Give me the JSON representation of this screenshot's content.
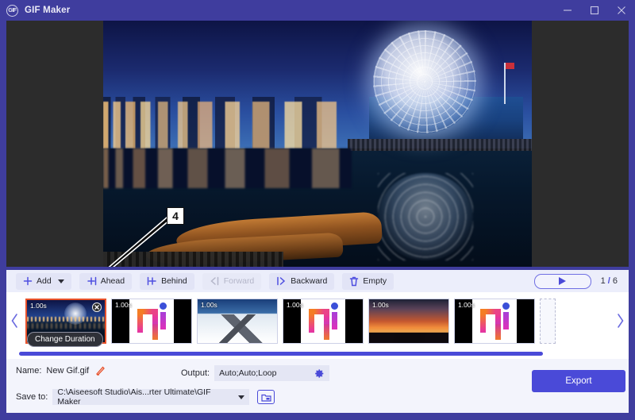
{
  "window": {
    "title": "GIF Maker",
    "app_icon": "gif-badge-icon",
    "minimize": "minimize-icon",
    "maximize": "maximize-icon",
    "close": "close-icon",
    "titlebar_color": "#3f3d9e"
  },
  "preview": {
    "description": "Night cityscape with illuminated geodesic dome, waterfront reflection and wooden canoes"
  },
  "annotation": {
    "number": "4",
    "arrow": "arrow-pointing-to-add-button"
  },
  "toolbar": {
    "buttons": [
      {
        "label": "Add",
        "icon": "plus-icon",
        "has_dropdown": true,
        "disabled": false
      },
      {
        "label": "Ahead",
        "icon": "insert-ahead-icon",
        "has_dropdown": false,
        "disabled": false
      },
      {
        "label": "Behind",
        "icon": "insert-behind-icon",
        "has_dropdown": false,
        "disabled": false
      },
      {
        "label": "Forward",
        "icon": "move-forward-icon",
        "has_dropdown": false,
        "disabled": true
      },
      {
        "label": "Backward",
        "icon": "move-backward-icon",
        "has_dropdown": false,
        "disabled": false
      },
      {
        "label": "Empty",
        "icon": "trash-icon",
        "has_dropdown": false,
        "disabled": false
      }
    ],
    "play_icon": "play-icon",
    "counter_current": "1",
    "counter_sep": "/",
    "counter_total": "6"
  },
  "strip": {
    "prev_icon": "chevron-left-icon",
    "next_icon": "chevron-right-icon",
    "tooltip": "Change Duration",
    "close_icon": "close-circle-icon",
    "frames": [
      {
        "duration": "1.00s",
        "kind": "citynight",
        "selected": true
      },
      {
        "duration": "1.00s",
        "kind": "ai-logo",
        "selected": false
      },
      {
        "duration": "1.00s",
        "kind": "mountain",
        "selected": false
      },
      {
        "duration": "1.00s",
        "kind": "ai-logo",
        "selected": false
      },
      {
        "duration": "1.00s",
        "kind": "sunset",
        "selected": false
      },
      {
        "duration": "1.00s",
        "kind": "ai-logo",
        "selected": false
      }
    ]
  },
  "bottom": {
    "name_label": "Name:",
    "name_value": "New Gif.gif",
    "edit_icon": "pencil-icon",
    "output_label": "Output:",
    "output_value": "Auto;Auto;Loop",
    "gear_icon": "gear-icon",
    "saveto_label": "Save to:",
    "saveto_value": "C:\\Aiseesoft Studio\\Ais...rter Ultimate\\GIF Maker",
    "dropdown_icon": "chevron-down-icon",
    "folder_icon": "folder-open-icon",
    "export_label": "Export"
  },
  "colors": {
    "accent": "#4a4ad8",
    "titlebar": "#3f3d9e",
    "selection": "#e8512a",
    "panel": "#f3f4fc",
    "toolbar": "#eceefb"
  }
}
